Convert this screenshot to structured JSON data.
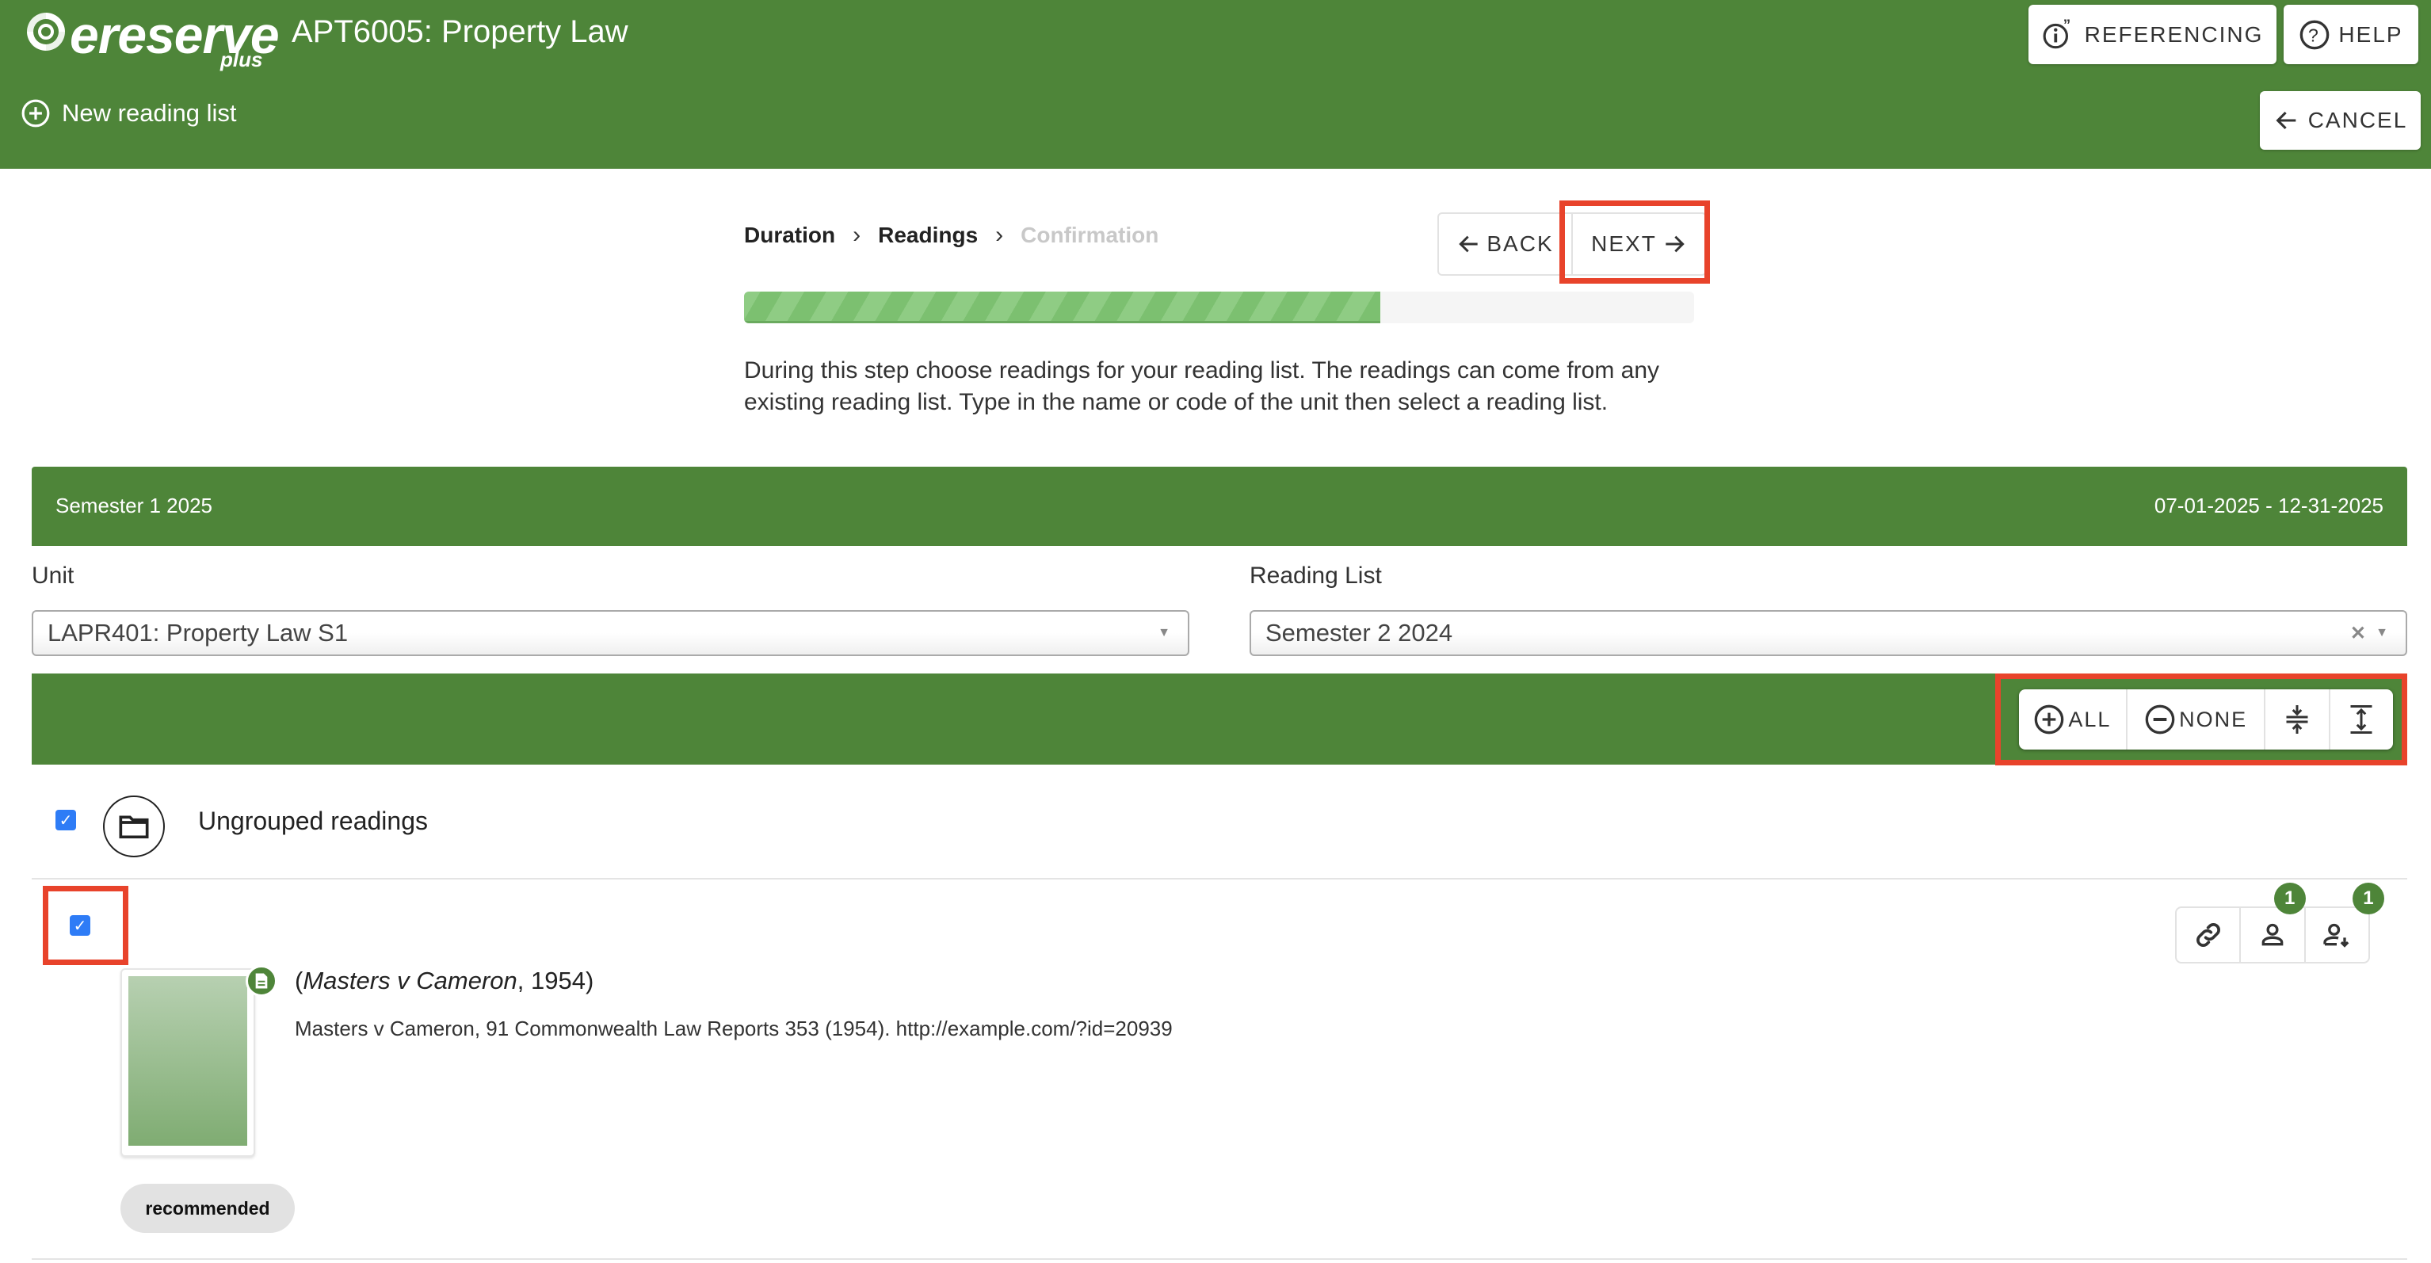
{
  "header": {
    "logo_text": "ereserve",
    "logo_sub": "plus",
    "title": "APT6005: Property Law",
    "new_list_label": "New reading list",
    "referencing_label": "REFERENCING",
    "help_label": "HELP",
    "cancel_label": "CANCEL"
  },
  "wizard": {
    "steps": [
      {
        "label": "Duration",
        "state": "done"
      },
      {
        "label": "Readings",
        "state": "current"
      },
      {
        "label": "Confirmation",
        "state": "pending"
      }
    ],
    "back_label": "BACK",
    "next_label": "NEXT",
    "progress_percent": 67,
    "description": "During this step choose readings for your reading list. The readings can come from any existing reading list. Type in the name or code of the unit then select a reading list."
  },
  "semester": {
    "name": "Semester 1 2025",
    "date_range": "07-01-2025 - 12-31-2025"
  },
  "filters": {
    "unit_label": "Unit",
    "unit_value": "LAPR401: Property Law S1",
    "reading_list_label": "Reading List",
    "reading_list_value": "Semester 2 2024"
  },
  "bulk": {
    "all_label": "ALL",
    "none_label": "NONE",
    "collapse_icon": "collapse-icon",
    "expand_icon": "expand-icon"
  },
  "group": {
    "label": "Ungrouped readings",
    "checked": true
  },
  "items": [
    {
      "checked": true,
      "title_italic": "Masters v Cameron",
      "title_rest": ", 1954)",
      "title_open": "(",
      "citation": "Masters v Cameron, 91 Commonwealth Law Reports 353 (1954). http://example.com/?id=20939",
      "tag": "recommended",
      "staff_count": "1",
      "student_count": "1"
    }
  ],
  "colors": {
    "brand_green": "#4e8539",
    "checkbox_blue": "#2e7cf6",
    "highlight_red": "#e8432b"
  }
}
